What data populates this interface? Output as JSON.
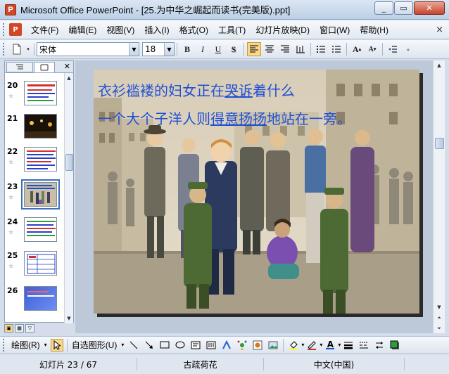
{
  "window": {
    "title": "Microsoft Office PowerPoint - [25.为中华之崛起而读书(完美版).ppt]",
    "minimize": "_",
    "restore": "▭",
    "close": "✕"
  },
  "menu": {
    "items": [
      "文件(F)",
      "编辑(E)",
      "视图(V)",
      "插入(I)",
      "格式(O)",
      "工具(T)",
      "幻灯片放映(D)",
      "窗口(W)",
      "帮助(H)"
    ],
    "close": "×"
  },
  "toolbar": {
    "font_name": "宋体",
    "font_size": "18",
    "bold": "B",
    "italic": "I",
    "underline": "U",
    "shadow": "S"
  },
  "slides_pane": {
    "slides": [
      {
        "num": "20",
        "thumb": "text-white"
      },
      {
        "num": "21",
        "thumb": "dark"
      },
      {
        "num": "22",
        "thumb": "text-white"
      },
      {
        "num": "23",
        "thumb": "picture",
        "selected": true
      },
      {
        "num": "24",
        "thumb": "text-white"
      },
      {
        "num": "25",
        "thumb": "table"
      },
      {
        "num": "26",
        "thumb": "blue"
      }
    ]
  },
  "slide": {
    "line1": [
      "衣衫褴褛的妇女正在",
      "哭诉",
      "着什么"
    ],
    "line2": [
      "一个大个子洋人则",
      "得意扬扬",
      "地站在一旁。"
    ]
  },
  "drawbar": {
    "draw_label": "绘图(R)",
    "autoshape_label": "自选图形(U)"
  },
  "status": {
    "slide_info": "幻灯片 23 / 67",
    "design": "古疏荷花",
    "language": "中文(中国)"
  },
  "colors": {
    "slide_text": "#1f4fd6",
    "active_button": "#fbd78b",
    "title_gradient": "#bcd0e6"
  }
}
